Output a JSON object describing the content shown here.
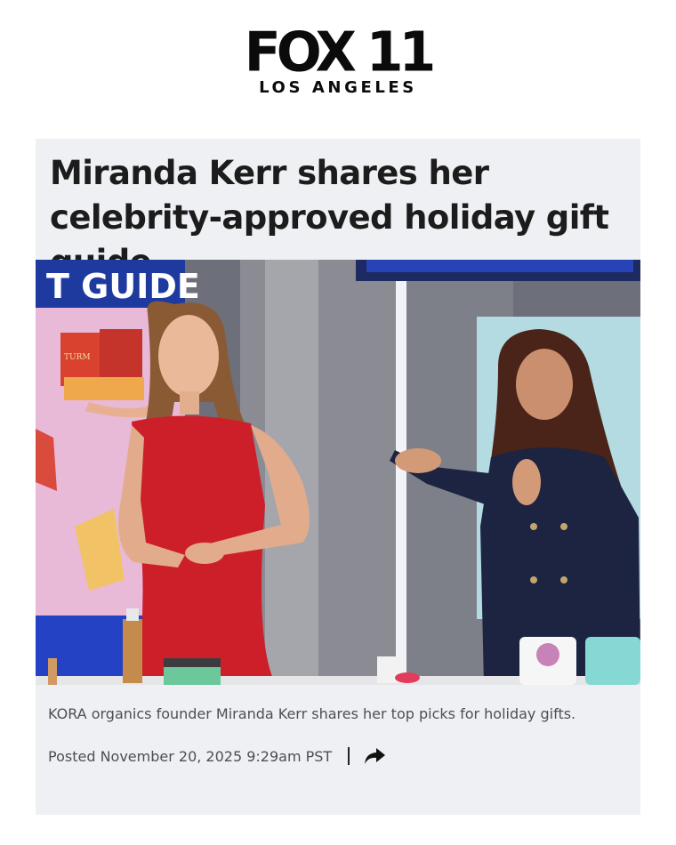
{
  "header": {
    "logo_main": "FOX 11",
    "logo_sub": "LOS ANGELES"
  },
  "article": {
    "headline": "Miranda Kerr shares her celebrity-approved holiday gift guide",
    "image": {
      "backdrop_text": "T GUIDE",
      "box_text": "TURM"
    },
    "caption": "KORA organics founder Miranda Kerr shares her top picks for holiday gifts.",
    "posted": "Posted November 20, 2025 9:29am PST"
  },
  "icons": {
    "share": "share-arrow-icon"
  },
  "colors": {
    "card_bg": "#eef0f3",
    "text": "#1c1c1c",
    "meta_text": "#4c4f55"
  }
}
